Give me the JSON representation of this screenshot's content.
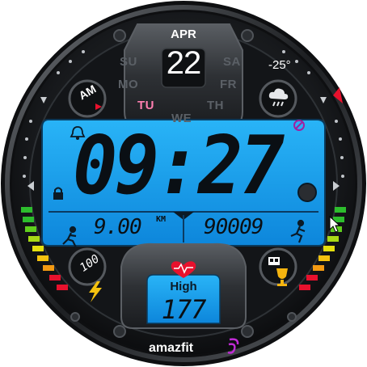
{
  "date": {
    "month": "APR",
    "day_number": "22"
  },
  "weekdays": [
    {
      "label": "SU",
      "active": false
    },
    {
      "label": "MO",
      "active": false
    },
    {
      "label": "TU",
      "active": true
    },
    {
      "label": "WE",
      "active": false
    },
    {
      "label": "TH",
      "active": false
    },
    {
      "label": "FR",
      "active": false
    },
    {
      "label": "SA",
      "active": false
    }
  ],
  "ampm": "AM",
  "weather": {
    "temperature": "-25°",
    "icon": "cloud-rain-icon"
  },
  "time": {
    "hours": "09",
    "minutes": "27"
  },
  "distance": {
    "value": "9.00",
    "unit": "KM"
  },
  "steps": {
    "value": "90009"
  },
  "heart_rate": {
    "label": "High",
    "value": "177"
  },
  "battery": {
    "value": "100"
  },
  "brand": "amazfit",
  "colors": {
    "lcd": "#19a9f5",
    "lcd_dark": "#0b83d6",
    "accent_red": "#e8112d",
    "active_day": "#ff7fb0"
  },
  "icons": [
    "bell-icon",
    "lock-icon",
    "no-disturb-icon",
    "runner-icon",
    "walker-icon",
    "heart-icon",
    "bolt-icon",
    "trophy-icon",
    "cloud-rain-icon"
  ]
}
